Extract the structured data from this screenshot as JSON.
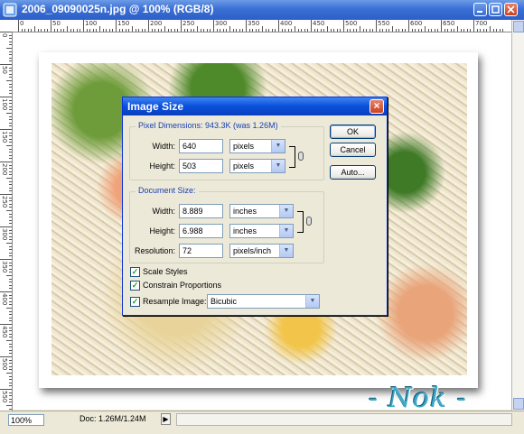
{
  "window": {
    "title": "2006_09090025n.jpg @ 100% (RGB/8)"
  },
  "ruler": {
    "top_labels": [
      "0",
      "50",
      "100",
      "150",
      "200",
      "250",
      "300",
      "350",
      "400",
      "450",
      "500",
      "550",
      "600",
      "650",
      "700"
    ],
    "left_labels": [
      "0",
      "50",
      "100",
      "150",
      "200",
      "250",
      "300",
      "350",
      "400",
      "450",
      "500",
      "550"
    ]
  },
  "dialog": {
    "title": "Image Size",
    "pixel_dimensions": {
      "legend": "Pixel Dimensions: 943.3K (was 1.26M)",
      "width_label": "Width:",
      "width_value": "640",
      "width_unit": "pixels",
      "height_label": "Height:",
      "height_value": "503",
      "height_unit": "pixels"
    },
    "document_size": {
      "legend": "Document Size:",
      "width_label": "Width:",
      "width_value": "8.889",
      "width_unit": "inches",
      "height_label": "Height:",
      "height_value": "6.988",
      "height_unit": "inches",
      "resolution_label": "Resolution:",
      "resolution_value": "72",
      "resolution_unit": "pixels/inch"
    },
    "options": {
      "scale_styles": {
        "label": "Scale Styles",
        "checked": true
      },
      "constrain_proportions": {
        "label": "Constrain Proportions",
        "checked": true
      },
      "resample_image": {
        "label": "Resample Image:",
        "checked": true,
        "method": "Bicubic"
      }
    },
    "buttons": {
      "ok": "OK",
      "cancel": "Cancel",
      "auto": "Auto..."
    }
  },
  "watermark": "- Nok -",
  "status": {
    "zoom": "100%",
    "doc_info": "Doc: 1.26M/1.24M",
    "arrow": "▶"
  },
  "colors": {
    "title_bar": "#2c5fc8",
    "dialog_title": "#0a50d8",
    "group_legend": "#1a3fb0",
    "watermark": "#3fa8c8"
  }
}
